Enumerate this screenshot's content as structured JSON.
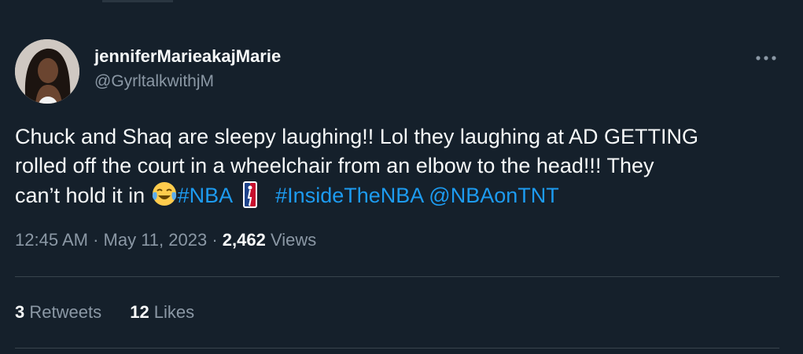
{
  "author": {
    "display_name": "jenniferMarieakajMarie",
    "handle": "@GyrltalkwithjM"
  },
  "tweet": {
    "line1": "Chuck and Shaq are sleepy laughing!! Lol they laughing at AD GETTING",
    "line2": "rolled off the court in a wheelchair from an elbow to the head!!! They",
    "line3_text": "can’t hold it in ",
    "hashtag_nba": "#NBA",
    "hashtag_inside": "#InsideTheNBA",
    "mention": "@NBAonTNT"
  },
  "meta": {
    "time": "12:45 AM",
    "sep1": " · ",
    "date": "May 11, 2023",
    "sep2": " · ",
    "views_count": "2,462",
    "views_label": " Views"
  },
  "stats": {
    "retweets_count": "3",
    "retweets_label": " Retweets",
    "likes_count": "12",
    "likes_label": " Likes"
  },
  "icons": {
    "more": "more-horizontal-icon",
    "emoji": "face-with-tears-of-joy-icon",
    "nba": "nba-logo-icon"
  },
  "colors": {
    "background": "#15202b",
    "text": "#f7f9f9",
    "secondary": "#8b98a5",
    "link": "#1d9bf0",
    "divider": "#38444d"
  }
}
